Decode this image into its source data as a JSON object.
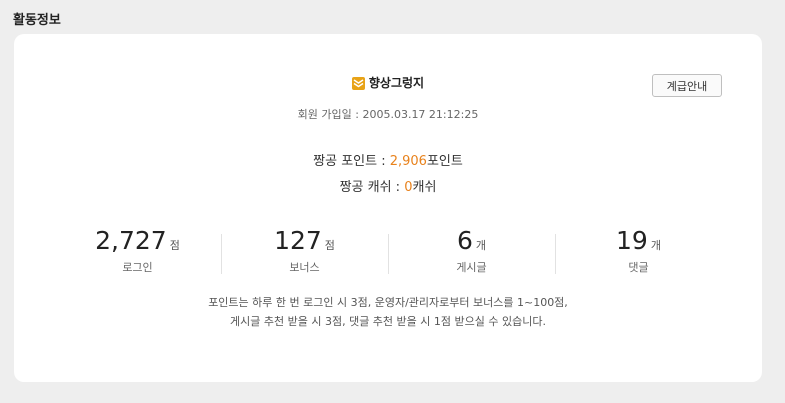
{
  "section": {
    "title": "활동정보"
  },
  "rank": {
    "icon": "rank-chevron-icon",
    "name": "향상그렁지",
    "button_label": "계급안내"
  },
  "member": {
    "joined_label": "회원 가입일 :",
    "joined_value": "2005.03.17 21:12:25"
  },
  "points": {
    "label": "짱공 포인트 :",
    "value": "2,906",
    "unit": "포인트"
  },
  "cash": {
    "label": "짱공 캐쉬 :",
    "value": "0",
    "unit": "캐쉬"
  },
  "stats": [
    {
      "value": "2,727",
      "unit": "점",
      "label": "로그인"
    },
    {
      "value": "127",
      "unit": "점",
      "label": "보너스"
    },
    {
      "value": "6",
      "unit": "개",
      "label": "게시글"
    },
    {
      "value": "19",
      "unit": "개",
      "label": "댓글"
    }
  ],
  "notice": {
    "line1": "포인트는 하루 한 번 로그인 시 3점, 운영자/관리자로부터 보너스를 1~100점,",
    "line2": "게시글 추천 받을 시 3점, 댓글 추천 받을 시 1점 받으실 수 있습니다."
  },
  "colors": {
    "accent": "#e8821c",
    "rank_icon": "#e8a317",
    "background": "#eeeeee"
  }
}
